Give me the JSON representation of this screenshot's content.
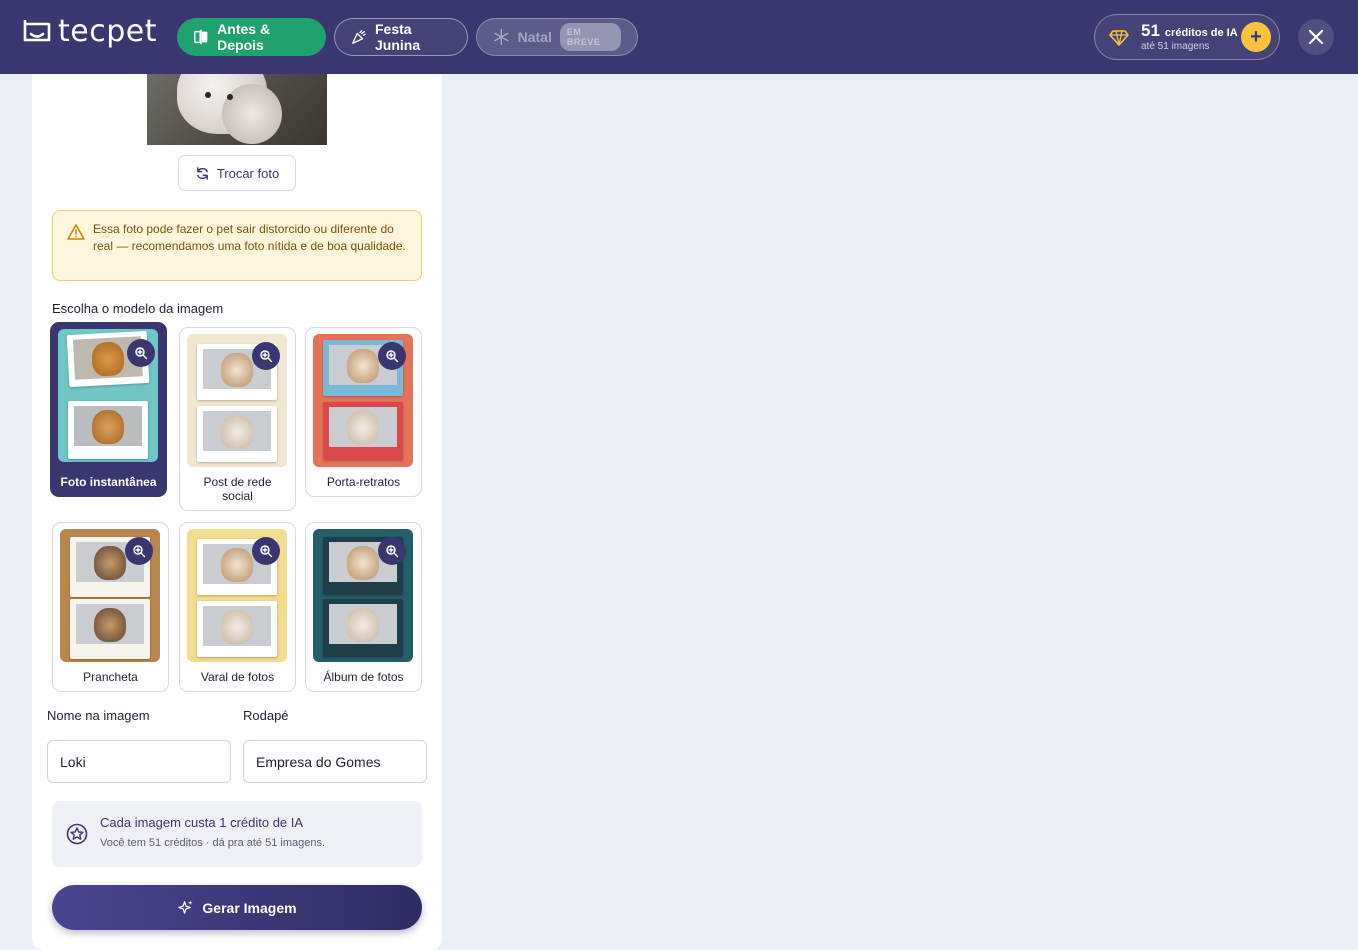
{
  "header": {
    "brand": "tecpet",
    "tabs": [
      {
        "label": "Antes & Depois",
        "icon": "before-after-icon",
        "state": "active"
      },
      {
        "label": "Festa Junina",
        "icon": "party-popper-icon",
        "state": "default"
      },
      {
        "label": "Natal",
        "icon": "snowflake-icon",
        "state": "disabled",
        "badge": "EM BREVE"
      }
    ],
    "credits": {
      "count": "51",
      "label": "créditos de IA",
      "sub": "até 51 imagens"
    },
    "add_label": "+"
  },
  "panel": {
    "swap_photo_label": "Trocar foto",
    "warning": "Essa foto pode fazer o pet sair distorcido ou diferente do real — recomendamos uma foto nítida e de boa qualidade.",
    "choose_model_label": "Escolha o modelo da imagem",
    "templates": [
      {
        "label": "Foto instantânea",
        "selected": true
      },
      {
        "label": "Post de rede social",
        "selected": false
      },
      {
        "label": "Porta-retratos",
        "selected": false
      },
      {
        "label": "Prancheta",
        "selected": false
      },
      {
        "label": "Varal de fotos",
        "selected": false
      },
      {
        "label": "Álbum de fotos",
        "selected": false
      }
    ],
    "name_label": "Nome na imagem",
    "name_value": "Loki",
    "footer_label": "Rodapé",
    "footer_value": "Empresa do Gomes",
    "info_title": "Cada imagem custa 1 crédito de IA",
    "info_sub": "Você tem 51 créditos · dá pra até 51 imagens.",
    "generate_label": "Gerar Imagem"
  },
  "colors": {
    "brand": "#3a3770",
    "active_tab": "#1fa26d",
    "accent_yellow": "#f9c23c",
    "warning_bg": "#fdf5dc"
  }
}
